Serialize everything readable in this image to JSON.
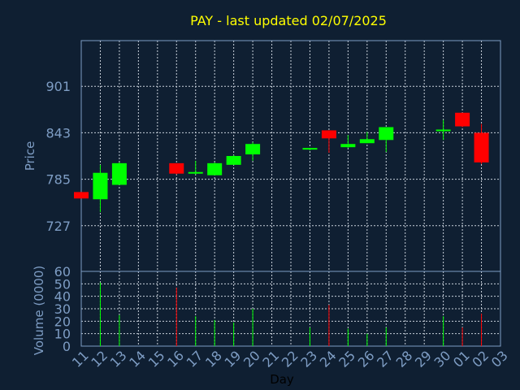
{
  "chart_data": {
    "type": "candlestick",
    "title": "PAY - last updated 02/07/2025",
    "price_panel": {
      "ylabel": "Price",
      "yticks": [
        727,
        785,
        843,
        901
      ],
      "ylim": [
        670,
        958
      ]
    },
    "volume_panel": {
      "ylabel": "Volume (0000)",
      "yticks": [
        0,
        10,
        20,
        30,
        40,
        50,
        60
      ],
      "ylim": [
        0,
        60
      ]
    },
    "xlabel": "Day",
    "x_ticks": [
      "11",
      "12",
      "13",
      "14",
      "15",
      "16",
      "17",
      "18",
      "19",
      "20",
      "21",
      "22",
      "23",
      "24",
      "25",
      "26",
      "27",
      "28",
      "29",
      "30",
      "01",
      "02",
      "03"
    ],
    "colors": {
      "up": "#00ff00",
      "down": "#ff0000",
      "title": "#ffff00",
      "axis": "#7e9dc4",
      "background": "#0f1f32"
    },
    "candles": [
      {
        "day": "11",
        "open": 769,
        "high": 769,
        "low": 761,
        "close": 761,
        "volume": 0
      },
      {
        "day": "12",
        "open": 760,
        "high": 803,
        "low": 744,
        "close": 793,
        "volume": 51
      },
      {
        "day": "13",
        "open": 778,
        "high": 806,
        "low": 778,
        "close": 805,
        "volume": 25
      },
      {
        "day": "16",
        "open": 805,
        "high": 805,
        "low": 791,
        "close": 792,
        "volume": 47
      },
      {
        "day": "17",
        "open": 792,
        "high": 808,
        "low": 791,
        "close": 794,
        "volume": 24
      },
      {
        "day": "18",
        "open": 790,
        "high": 806,
        "low": 790,
        "close": 805,
        "volume": 21
      },
      {
        "day": "19",
        "open": 803,
        "high": 815,
        "low": 803,
        "close": 814,
        "volume": 19
      },
      {
        "day": "20",
        "open": 816,
        "high": 831,
        "low": 808,
        "close": 829,
        "volume": 30
      },
      {
        "day": "23",
        "open": 822,
        "high": 824,
        "low": 821,
        "close": 824,
        "volume": 15
      },
      {
        "day": "24",
        "open": 846,
        "high": 846,
        "low": 818,
        "close": 836,
        "volume": 33
      },
      {
        "day": "25",
        "open": 825,
        "high": 840,
        "low": 824,
        "close": 829,
        "volume": 14
      },
      {
        "day": "26",
        "open": 830,
        "high": 844,
        "low": 830,
        "close": 835,
        "volume": 10
      },
      {
        "day": "27",
        "open": 834,
        "high": 850,
        "low": 819,
        "close": 850,
        "volume": 15
      },
      {
        "day": "30",
        "open": 847,
        "high": 859,
        "low": 834,
        "close": 847,
        "volume": 24
      },
      {
        "day": "01",
        "open": 868,
        "high": 868,
        "low": 850,
        "close": 851,
        "volume": 15
      },
      {
        "day": "02",
        "open": 843,
        "high": 854,
        "low": 804,
        "close": 806,
        "volume": 26
      }
    ]
  }
}
